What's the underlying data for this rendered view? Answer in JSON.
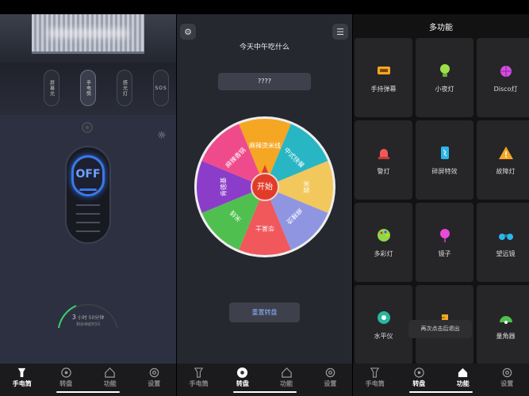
{
  "flashlight": {
    "modes": [
      "屏幕光",
      "手电筒",
      "感光灯",
      "SOS"
    ],
    "switch_label": "OFF",
    "timer_hours": "3",
    "timer_text": "小时 50分钟",
    "timer_subtext": "剩余续航时间"
  },
  "wheel": {
    "question": "今天中午吃什么",
    "result": "????",
    "start_label": "开始",
    "reset_label": "重置转盘",
    "segments": [
      {
        "label": "麻辣烫米线",
        "color": "#f5a623"
      },
      {
        "label": "中式快餐",
        "color": "#29b6c4"
      },
      {
        "label": "米饭",
        "color": "#f2c75c"
      },
      {
        "label": "麻辣烫",
        "color": "#8f95e0"
      },
      {
        "label": "华莱士",
        "color": "#f0585c"
      },
      {
        "label": "米线",
        "color": "#4fc04f"
      },
      {
        "label": "肯德基",
        "color": "#8b3dc9"
      },
      {
        "label": "麻辣香锅",
        "color": "#ef4b8c"
      }
    ]
  },
  "multi": {
    "title": "多功能",
    "items": [
      {
        "label": "手持弹幕",
        "icon": "banner-icon"
      },
      {
        "label": "小夜灯",
        "icon": "bulb-icon"
      },
      {
        "label": "Disco灯",
        "icon": "disco-icon"
      },
      {
        "label": "警灯",
        "icon": "siren-icon"
      },
      {
        "label": "碎屏特效",
        "icon": "broken-screen-icon"
      },
      {
        "label": "故障灯",
        "icon": "warning-icon"
      },
      {
        "label": "多彩灯",
        "icon": "palette-icon"
      },
      {
        "label": "镜子",
        "icon": "mirror-icon"
      },
      {
        "label": "望远镜",
        "icon": "binoculars-icon"
      },
      {
        "label": "水平仪",
        "icon": "level-icon"
      },
      {
        "label": "",
        "icon": "ruler-icon"
      },
      {
        "label": "量角器",
        "icon": "protractor-icon"
      }
    ],
    "toast": "再次点击后退出"
  },
  "tabs": {
    "t1": "手电筒",
    "t2": "转盘",
    "t3": "功能",
    "t4": "设置"
  },
  "screen3_tabs": {
    "t1": "手电筒",
    "t2": "转盘",
    "t3": "功能",
    "t4": "设置"
  },
  "colors": {
    "accent_blue": "#3b78e8",
    "timer_green": "#3ccf6e"
  }
}
